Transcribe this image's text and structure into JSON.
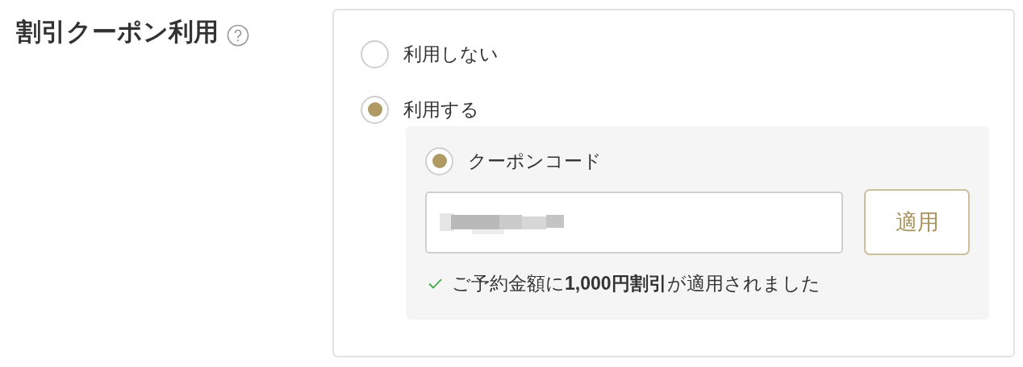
{
  "title": "割引クーポン利用",
  "options": [
    {
      "label": "利用しない",
      "selected": false
    },
    {
      "label": "利用する",
      "selected": true,
      "coupon": {
        "methods": [
          {
            "label": "クーポンコード",
            "selected": true
          }
        ],
        "apply_button": "適用",
        "message": "ご予約金額に**1,000円割引**が適用されました"
      }
    }
  ]
}
